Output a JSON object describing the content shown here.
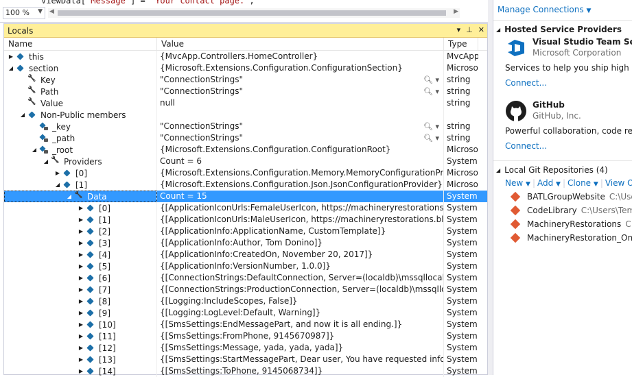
{
  "editor": {
    "code_prefix": "ViewData[",
    "code_key": "\"Message\"",
    "code_mid": "] = ",
    "code_str": "\"Your contact page.\"",
    "code_suffix": ";",
    "zoom": "100 %"
  },
  "locals": {
    "title": "Locals",
    "columns": {
      "name": "Name",
      "value": "Value",
      "type": "Type"
    },
    "rows": [
      {
        "indent": 0,
        "exp": "▶",
        "icon": "obj",
        "name": "this",
        "value": "{MvcApp.Controllers.HomeController}",
        "type": "MvcApp",
        "mag": false
      },
      {
        "indent": 0,
        "exp": "◢",
        "icon": "obj",
        "name": "section",
        "value": "{Microsoft.Extensions.Configuration.ConfigurationSection}",
        "type": "Microsof",
        "mag": false
      },
      {
        "indent": 1,
        "exp": "",
        "icon": "wrench",
        "name": "Key",
        "value": "\"ConnectionStrings\"",
        "type": "string",
        "mag": true
      },
      {
        "indent": 1,
        "exp": "",
        "icon": "wrench",
        "name": "Path",
        "value": "\"ConnectionStrings\"",
        "type": "string",
        "mag": true
      },
      {
        "indent": 1,
        "exp": "",
        "icon": "wrench",
        "name": "Value",
        "value": "null",
        "type": "string",
        "mag": false
      },
      {
        "indent": 1,
        "exp": "◢",
        "icon": "obj",
        "name": "Non-Public members",
        "value": "",
        "type": "",
        "mag": false
      },
      {
        "indent": 2,
        "exp": "",
        "icon": "lock-obj",
        "name": "_key",
        "value": "\"ConnectionStrings\"",
        "type": "string",
        "mag": true
      },
      {
        "indent": 2,
        "exp": "",
        "icon": "lock-obj",
        "name": "_path",
        "value": "\"ConnectionStrings\"",
        "type": "string",
        "mag": true
      },
      {
        "indent": 2,
        "exp": "◢",
        "icon": "lock-obj",
        "name": "_root",
        "value": "{Microsoft.Extensions.Configuration.ConfigurationRoot}",
        "type": "Microsof",
        "mag": false
      },
      {
        "indent": 3,
        "exp": "◢",
        "icon": "wrench",
        "name": "Providers",
        "value": "Count = 6",
        "type": "System.C",
        "mag": false
      },
      {
        "indent": 4,
        "exp": "▶",
        "icon": "obj",
        "name": "[0]",
        "value": "{Microsoft.Extensions.Configuration.Memory.MemoryConfigurationProvider}",
        "type": "Microsof",
        "mag": false
      },
      {
        "indent": 4,
        "exp": "◢",
        "icon": "obj",
        "name": "[1]",
        "value": "{Microsoft.Extensions.Configuration.Json.JsonConfigurationProvider}",
        "type": "Microsof",
        "mag": false
      },
      {
        "indent": 5,
        "exp": "◢",
        "icon": "wrench",
        "name": "Data",
        "value": "Count = 15",
        "type": "System.C",
        "mag": false,
        "selected": true
      },
      {
        "indent": 6,
        "exp": "▶",
        "icon": "obj",
        "name": "[0]",
        "value": "{[ApplicationIconUrls:FemaleUserIcon, https://machineryrestorations.blob.core.",
        "type": "System.C",
        "mag": false
      },
      {
        "indent": 6,
        "exp": "▶",
        "icon": "obj",
        "name": "[1]",
        "value": "{[ApplicationIconUrls:MaleUserIcon, https://machineryrestorations.blob.core.w",
        "type": "System.C",
        "mag": false
      },
      {
        "indent": 6,
        "exp": "▶",
        "icon": "obj",
        "name": "[2]",
        "value": "{[ApplicationInfo:ApplicationName, CustomTemplate]}",
        "type": "System.C",
        "mag": false
      },
      {
        "indent": 6,
        "exp": "▶",
        "icon": "obj",
        "name": "[3]",
        "value": "{[ApplicationInfo:Author, Tom Donino]}",
        "type": "System.C",
        "mag": false
      },
      {
        "indent": 6,
        "exp": "▶",
        "icon": "obj",
        "name": "[4]",
        "value": "{[ApplicationInfo:CreatedOn, November 20, 2017]}",
        "type": "System.C",
        "mag": false
      },
      {
        "indent": 6,
        "exp": "▶",
        "icon": "obj",
        "name": "[5]",
        "value": "{[ApplicationInfo:VersionNumber, 1.0.0]}",
        "type": "System.C",
        "mag": false
      },
      {
        "indent": 6,
        "exp": "▶",
        "icon": "obj",
        "name": "[6]",
        "value": "{[ConnectionStrings:DefaultConnection, Server=(localdb)\\mssqllocaldb;Databa",
        "type": "System.C",
        "mag": false
      },
      {
        "indent": 6,
        "exp": "▶",
        "icon": "obj",
        "name": "[7]",
        "value": "{[ConnectionStrings:ProductionConnection, Server=(localdb)\\mssqllocaldb;Da",
        "type": "System.C",
        "mag": false
      },
      {
        "indent": 6,
        "exp": "▶",
        "icon": "obj",
        "name": "[8]",
        "value": "{[Logging:IncludeScopes, False]}",
        "type": "System.C",
        "mag": false
      },
      {
        "indent": 6,
        "exp": "▶",
        "icon": "obj",
        "name": "[9]",
        "value": "{[Logging:LogLevel:Default, Warning]}",
        "type": "System.C",
        "mag": false
      },
      {
        "indent": 6,
        "exp": "▶",
        "icon": "obj",
        "name": "[10]",
        "value": "{[SmsSettings:EndMessagePart, and now it is all ending.]}",
        "type": "System.C",
        "mag": false
      },
      {
        "indent": 6,
        "exp": "▶",
        "icon": "obj",
        "name": "[11]",
        "value": "{[SmsSettings:FromPhone, 9145670987]}",
        "type": "System.C",
        "mag": false
      },
      {
        "indent": 6,
        "exp": "▶",
        "icon": "obj",
        "name": "[12]",
        "value": "{[SmsSettings:Message, yada, yada, yada]}",
        "type": "System.C",
        "mag": false
      },
      {
        "indent": 6,
        "exp": "▶",
        "icon": "obj",
        "name": "[13]",
        "value": "{[SmsSettings:StartMessagePart, Dear user, You have requested info from us on",
        "type": "System.C",
        "mag": false
      },
      {
        "indent": 6,
        "exp": "▶",
        "icon": "obj",
        "name": "[14]",
        "value": "{[SmsSettings:ToPhone, 9145068734]}",
        "type": "System.C",
        "mag": false
      }
    ]
  },
  "team": {
    "manage": "Manage Connections",
    "hosted_title": "Hosted Service Providers",
    "providers": [
      {
        "name": "Visual Studio Team Services",
        "corp": "Microsoft Corporation",
        "desc": "Services to help you ship high quali",
        "connect": "Connect..."
      },
      {
        "name": "GitHub",
        "corp": "GitHub, Inc.",
        "desc": "Powerful collaboration, code review",
        "connect": "Connect..."
      }
    ],
    "git_title": "Local Git Repositories (4)",
    "git_actions": {
      "new": "New",
      "add": "Add",
      "clone": "Clone",
      "view": "View Op"
    },
    "repos": [
      {
        "name": "BATLGroupWebsite",
        "path": "C:\\User"
      },
      {
        "name": "CodeLibrary",
        "path": "C:\\Users\\Temp"
      },
      {
        "name": "MachineryRestorations",
        "path": "C:\\U"
      },
      {
        "name": "MachineryRestoration_OneU",
        "path": ""
      }
    ]
  },
  "colors": {
    "selected_row": "#3399ff",
    "titlebar": "#ffef99",
    "link": "#0e70c0",
    "git_icon": "#e05a33",
    "object_icon": "#1c6fa8"
  }
}
